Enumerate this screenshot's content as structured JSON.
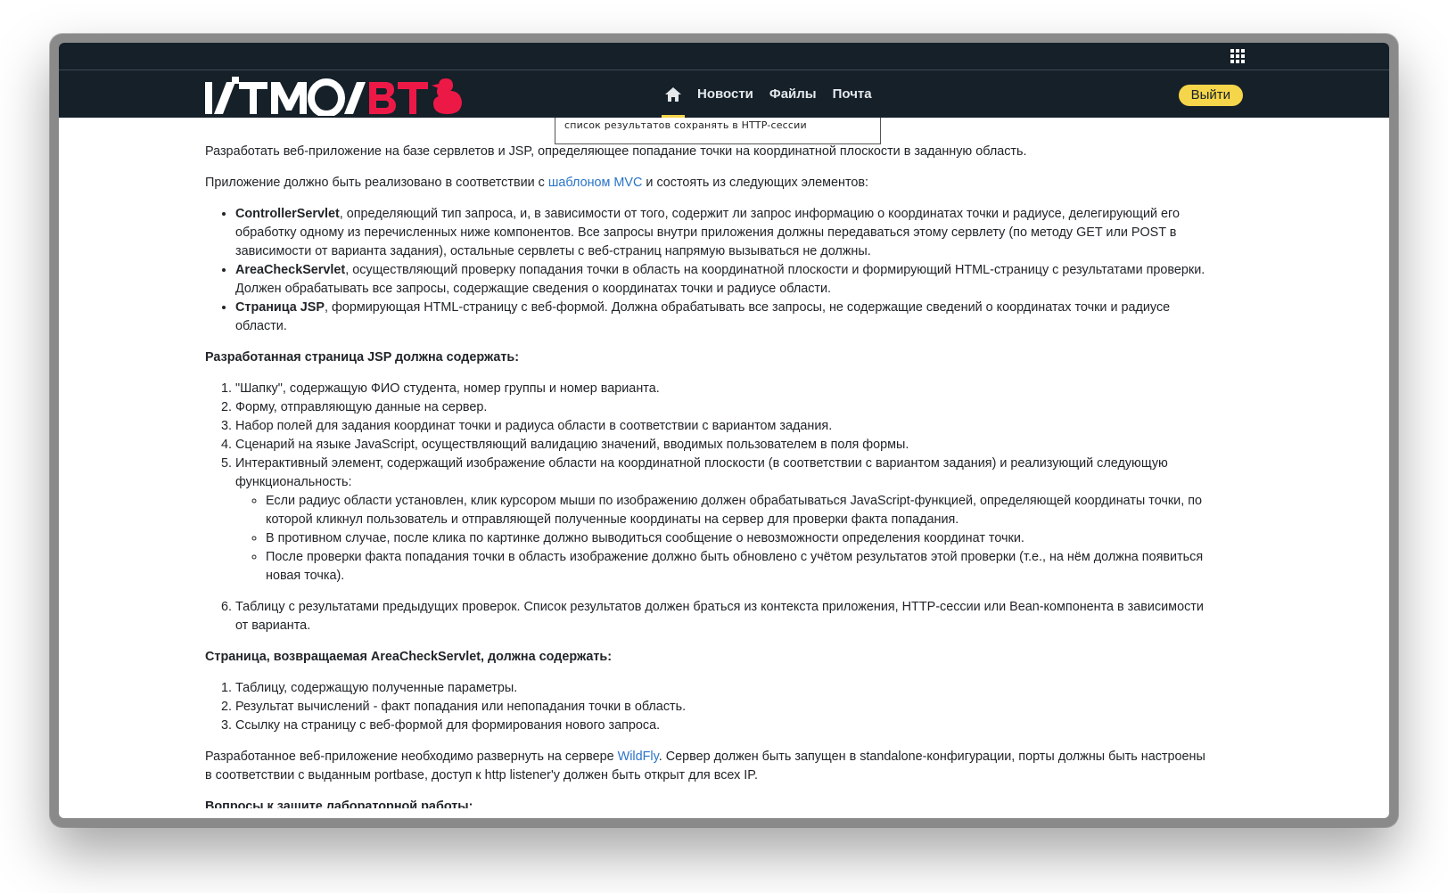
{
  "header": {
    "nav": [
      {
        "label": "Новости"
      },
      {
        "label": "Файлы"
      },
      {
        "label": "Почта"
      }
    ],
    "logout_label": "Выйти"
  },
  "tooltip": "список результатов сохранять в HTTP-сессии",
  "content": {
    "intro": "Разработать веб-приложение на базе сервлетов и JSP, определяющее попадание точки на координатной плоскости в заданную область.",
    "mvc_before": "Приложение должно быть реализовано в соответствии с ",
    "mvc_link": "шаблоном MVC",
    "mvc_after": " и состоять из следующих элементов:",
    "components": [
      {
        "name": "ControllerServlet",
        "text": ", определяющий тип запроса, и, в зависимости от того, содержит ли запрос информацию о координатах точки и радиусе, делегирующий его обработку одному из перечисленных ниже компонентов. Все запросы внутри приложения должны передаваться этому сервлету (по методу GET или POST в зависимости от варианта задания), остальные сервлеты с веб-страниц напрямую вызываться не должны."
      },
      {
        "name": "AreaCheckServlet",
        "text": ", осуществляющий проверку попадания точки в область на координатной плоскости и формирующий HTML-страницу с результатами проверки. Должен обрабатывать все запросы, содержащие сведения о координатах точки и радиусе области."
      },
      {
        "name": "Страница JSP",
        "text": ", формирующая HTML-страницу с веб-формой. Должна обрабатывать все запросы, не содержащие сведений о координатах точки и радиусе области."
      }
    ],
    "jsp_heading": "Разработанная страница JSP должна содержать:",
    "jsp_items": [
      "\"Шапку\", содержащую ФИО студента, номер группы и номер варианта.",
      "Форму, отправляющую данные на сервер.",
      "Набор полей для задания координат точки и радиуса области в соответствии с вариантом задания.",
      "Сценарий на языке JavaScript, осуществляющий валидацию значений, вводимых пользователем в поля формы.",
      "Интерактивный элемент, содержащий изображение области на координатной плоскости (в соответствии с вариантом задания) и реализующий следующую функциональность:",
      "Таблицу с результатами предыдущих проверок. Список результатов должен браться из контекста приложения, HTTP-сессии или Bean-компонента в зависимости от варианта."
    ],
    "interactive_subitems": [
      "Если радиус области установлен, клик курсором мыши по изображению должен обрабатываться JavaScript-функцией, определяющей координаты точки, по которой кликнул пользователь и отправляющей полученные координаты на сервер для проверки факта попадания.",
      "В противном случае, после клика по картинке должно выводиться сообщение о невозможности определения координат точки.",
      "После проверки факта попадания точки в область изображение должно быть обновлено с учётом результатов этой проверки (т.е., на нём должна появиться новая точка)."
    ],
    "area_heading": "Страница, возвращаемая AreaCheckServlet, должна содержать:",
    "area_items": [
      "Таблицу, содержащую полученные параметры.",
      "Результат вычислений - факт попадания или непопадания точки в область.",
      "Ссылку на страницу с веб-формой для формирования нового запроса."
    ],
    "wildfly_before": "Разработанное веб-приложение необходимо развернуть на сервере ",
    "wildfly_link": "WildFly",
    "wildfly_after": ". Сервер должен быть запущен в standalone-конфигурации, порты должны быть настроены в соответствии с выданным portbase, доступ к http listener'у должен быть открыт для всех IP.",
    "questions_heading": "Вопросы к защите лабораторной работы:"
  }
}
